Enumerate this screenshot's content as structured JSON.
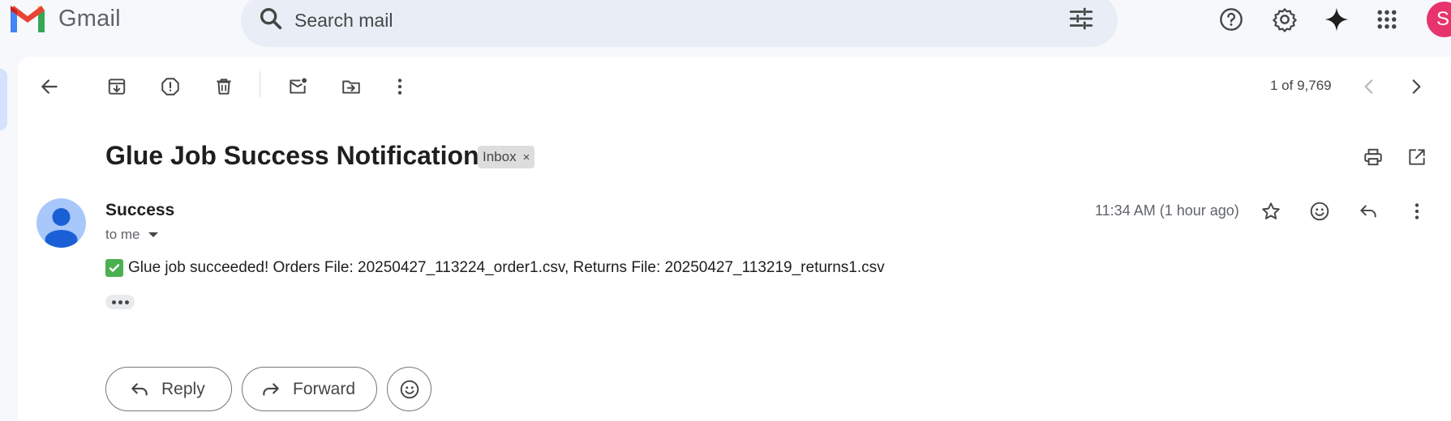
{
  "app": {
    "name": "Gmail"
  },
  "search": {
    "placeholder": "Search mail"
  },
  "toolbar": {
    "counter": "1 of 9,769"
  },
  "email": {
    "subject": "Glue Job Success Notification",
    "label": "Inbox",
    "label_remove": "×",
    "sender": "Success",
    "recipient": "to me",
    "timestamp": "11:34 AM (1 hour ago)",
    "body": "Glue job succeeded! Orders File: 20250427_113224_order1.csv, Returns File: 20250427_113219_returns1.csv"
  },
  "actions": {
    "reply": "Reply",
    "forward": "Forward"
  },
  "user": {
    "initial": "S",
    "avatar_color": "#e8336d"
  },
  "icons": [
    "search-icon",
    "tune-icon",
    "help-icon",
    "gear-icon",
    "gemini-icon",
    "apps-icon",
    "back-icon",
    "archive-icon",
    "report-spam-icon",
    "delete-icon",
    "mark-unread-icon",
    "move-to-icon",
    "more-icon",
    "chevron-left-icon",
    "chevron-right-icon",
    "print-icon",
    "open-new-window-icon",
    "star-icon",
    "emoji-icon",
    "reply-icon"
  ],
  "colors": {
    "background": "#f6f8fc",
    "search_bg": "#e9eef6",
    "sender_avatar": "#a8c7fa"
  }
}
